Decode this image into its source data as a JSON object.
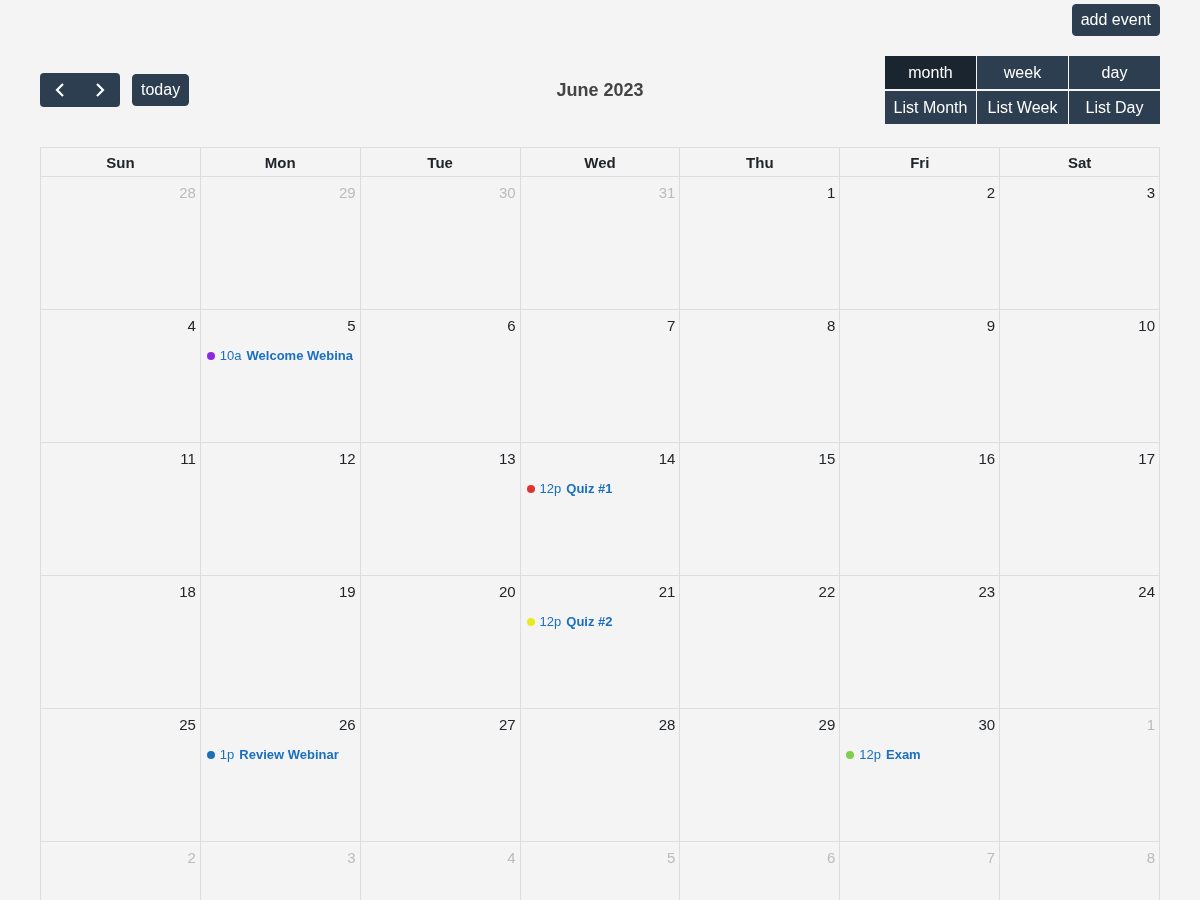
{
  "add_event_button": "add event",
  "toolbar": {
    "today_button": "today",
    "title": "June 2023",
    "views": [
      {
        "label": "month",
        "selected": true
      },
      {
        "label": "week",
        "selected": false
      },
      {
        "label": "day",
        "selected": false
      },
      {
        "label": "List Month",
        "selected": false
      },
      {
        "label": "List Week",
        "selected": false
      },
      {
        "label": "List Day",
        "selected": false
      }
    ]
  },
  "weekdays": [
    "Sun",
    "Mon",
    "Tue",
    "Wed",
    "Thu",
    "Fri",
    "Sat"
  ],
  "weeks": [
    {
      "days": [
        {
          "number": "28",
          "other_month": true
        },
        {
          "number": "29",
          "other_month": true
        },
        {
          "number": "30",
          "other_month": true
        },
        {
          "number": "31",
          "other_month": true
        },
        {
          "number": "1",
          "other_month": false
        },
        {
          "number": "2",
          "other_month": false
        },
        {
          "number": "3",
          "other_month": false
        }
      ]
    },
    {
      "days": [
        {
          "number": "4",
          "other_month": false
        },
        {
          "number": "5",
          "other_month": false,
          "events": [
            {
              "time": "10a",
              "title": "Welcome Webina",
              "color": "#8a2be2"
            }
          ]
        },
        {
          "number": "6",
          "other_month": false
        },
        {
          "number": "7",
          "other_month": false
        },
        {
          "number": "8",
          "other_month": false
        },
        {
          "number": "9",
          "other_month": false
        },
        {
          "number": "10",
          "other_month": false
        }
      ]
    },
    {
      "days": [
        {
          "number": "11",
          "other_month": false
        },
        {
          "number": "12",
          "other_month": false
        },
        {
          "number": "13",
          "other_month": false
        },
        {
          "number": "14",
          "other_month": false,
          "events": [
            {
              "time": "12p",
              "title": "Quiz #1",
              "color": "#e03333"
            }
          ]
        },
        {
          "number": "15",
          "other_month": false
        },
        {
          "number": "16",
          "other_month": false
        },
        {
          "number": "17",
          "other_month": false
        }
      ]
    },
    {
      "days": [
        {
          "number": "18",
          "other_month": false
        },
        {
          "number": "19",
          "other_month": false
        },
        {
          "number": "20",
          "other_month": false
        },
        {
          "number": "21",
          "other_month": false,
          "events": [
            {
              "time": "12p",
              "title": "Quiz #2",
              "color": "#e8e823"
            }
          ]
        },
        {
          "number": "22",
          "other_month": false
        },
        {
          "number": "23",
          "other_month": false
        },
        {
          "number": "24",
          "other_month": false
        }
      ]
    },
    {
      "days": [
        {
          "number": "25",
          "other_month": false
        },
        {
          "number": "26",
          "other_month": false,
          "events": [
            {
              "time": "1p",
              "title": "Review Webinar",
              "color": "#1e6fb8"
            }
          ]
        },
        {
          "number": "27",
          "other_month": false
        },
        {
          "number": "28",
          "other_month": false
        },
        {
          "number": "29",
          "other_month": false
        },
        {
          "number": "30",
          "other_month": false,
          "events": [
            {
              "time": "12p",
              "title": "Exam",
              "color": "#7ed04b"
            }
          ]
        },
        {
          "number": "1",
          "other_month": true
        }
      ]
    },
    {
      "days": [
        {
          "number": "2",
          "other_month": true
        },
        {
          "number": "3",
          "other_month": true
        },
        {
          "number": "4",
          "other_month": true
        },
        {
          "number": "5",
          "other_month": true
        },
        {
          "number": "6",
          "other_month": true
        },
        {
          "number": "7",
          "other_month": true
        },
        {
          "number": "8",
          "other_month": true
        }
      ]
    }
  ]
}
